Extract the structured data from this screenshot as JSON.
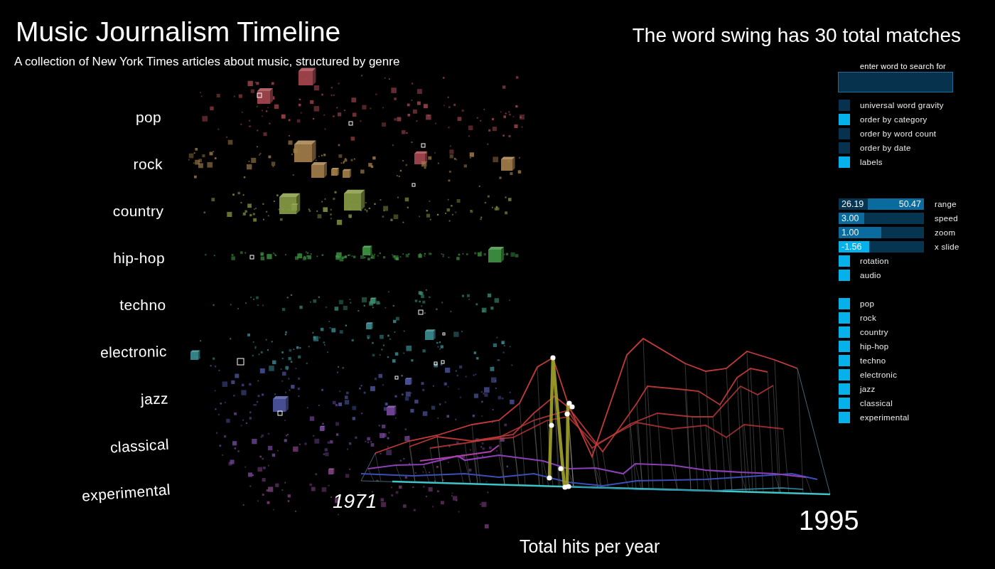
{
  "header": {
    "title": "Music Journalism Timeline",
    "subtitle": "A collection of New York Times articles about music, structured by genre"
  },
  "match_summary": "The word swing has 30 total matches",
  "genre_labels": [
    "pop",
    "rock",
    "country",
    "hip-hop",
    "techno",
    "electronic",
    "jazz",
    "classical",
    "experimental"
  ],
  "timeline_chart": {
    "start_year": "1971",
    "end_year": "1995",
    "axis_caption": "Total hits per year"
  },
  "control_panel": {
    "search": {
      "label": "enter word to search for"
    },
    "options": [
      {
        "label": "universal word gravity",
        "checked": false
      },
      {
        "label": "order by category",
        "checked": true
      },
      {
        "label": "order by word count",
        "checked": false
      },
      {
        "label": "order by date",
        "checked": false
      },
      {
        "label": "labels",
        "checked": true
      }
    ],
    "sliders": [
      {
        "kind": "range",
        "label": "range",
        "highlighted": false,
        "low_reading": "26.19",
        "high_reading": "50.47",
        "level": 0.66
      },
      {
        "kind": "single",
        "label": "speed",
        "highlighted": false,
        "reading": "3.00",
        "level": 0.3
      },
      {
        "kind": "single",
        "label": "zoom",
        "highlighted": false,
        "reading": "1.00",
        "level": 0.5
      },
      {
        "kind": "single",
        "label": "x slide",
        "highlighted": true,
        "reading": "-1.56",
        "level": 0.36
      }
    ],
    "toggles": [
      {
        "label": "rotation",
        "checked": true
      },
      {
        "label": "audio",
        "checked": true
      }
    ],
    "genre_filters": [
      {
        "label": "pop",
        "checked": true
      },
      {
        "label": "rock",
        "checked": true
      },
      {
        "label": "country",
        "checked": true
      },
      {
        "label": "hip-hop",
        "checked": true
      },
      {
        "label": "techno",
        "checked": true
      },
      {
        "label": "electronic",
        "checked": true
      },
      {
        "label": "jazz",
        "checked": true
      },
      {
        "label": "classical",
        "checked": true
      },
      {
        "label": "experimental",
        "checked": true
      }
    ]
  }
}
